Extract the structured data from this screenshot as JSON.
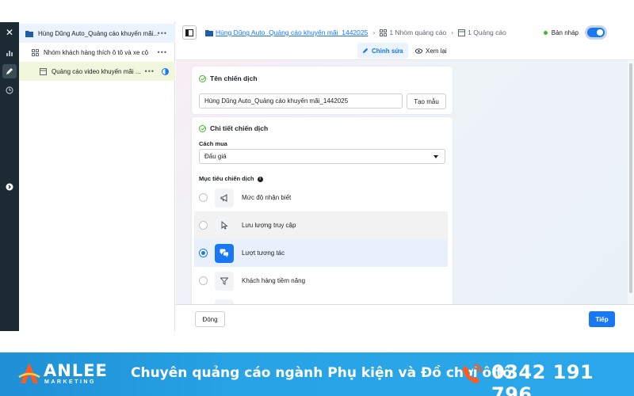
{
  "tree": {
    "campaign": "Hùng Dũng Auto_Quảng cáo khuyến mãi...",
    "adset": "Nhóm khách hàng thích ô tô và xe cộ",
    "ad": "Quảng cáo video khuyến mãi ...",
    "more": "•••"
  },
  "topbar": {
    "campaign_link": "Hùng Dũng Auto_Quảng cáo khuyến mãi_1442025",
    "adsets": "1 Nhóm quảng cáo",
    "ads": "1 Quảng cáo",
    "status": "Bản nháp"
  },
  "tabs": {
    "edit": "Chỉnh sửa",
    "review": "Xem lại"
  },
  "campaign_name": {
    "title": "Tên chiến dịch",
    "value": "Hùng Dũng Auto_Quảng cáo khuyến mãi_1442025",
    "template_button": "Tạo mẫu"
  },
  "details": {
    "title": "Chi tiết chiến dịch",
    "buying_label": "Cách mua",
    "buying_value": "Đấu giá",
    "objective_label": "Mục tiêu chiến dịch",
    "info": "i",
    "objectives": [
      {
        "label": "Mức độ nhận biết",
        "icon": "megaphone-icon"
      },
      {
        "label": "Lưu lượng truy cập",
        "icon": "cursor-icon"
      },
      {
        "label": "Lượt tương tác",
        "icon": "chat-bubbles-icon",
        "selected": true
      },
      {
        "label": "Khách hàng tiềm năng",
        "icon": "funnel-icon"
      }
    ]
  },
  "footer": {
    "close": "Đóng",
    "next": "Tiếp"
  },
  "banner": {
    "brand": "ANLEE",
    "brand_sub": "MARKETING",
    "tagline": "Chuyên quảng cáo ngành Phụ kiện và Đồ chơi ô tô",
    "phone": "0342 191 796"
  },
  "colors": {
    "accent": "#1877f2",
    "banner": "#28a4e6",
    "rail": "#1c2b33"
  }
}
